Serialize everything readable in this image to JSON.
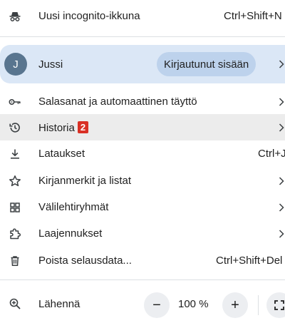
{
  "menu": {
    "incognito": {
      "label": "Uusi incognito-ikkuna",
      "shortcut": "Ctrl+Shift+N"
    },
    "profile": {
      "avatar_letter": "J",
      "name": "Jussi",
      "status": "Kirjautunut sisään"
    },
    "items": [
      {
        "label": "Salasanat ja automaattinen täyttö",
        "icon": "key-icon",
        "submenu": true
      },
      {
        "label": "Historia",
        "badge": "2",
        "icon": "history-icon",
        "submenu": true
      },
      {
        "label": "Lataukset",
        "shortcut": "Ctrl+J",
        "icon": "download-icon"
      },
      {
        "label": "Kirjanmerkit ja listat",
        "icon": "star-icon",
        "submenu": true
      },
      {
        "label": "Välilehtiryhmät",
        "icon": "tab-groups-icon",
        "submenu": true
      },
      {
        "label": "Laajennukset",
        "icon": "puzzle-icon",
        "submenu": true
      },
      {
        "label": "Poista selausdata...",
        "shortcut": "Ctrl+Shift+Del",
        "icon": "trash-icon"
      }
    ],
    "zoom": {
      "label": "Lähennä",
      "minus": "−",
      "value": "100 %",
      "plus": "+"
    }
  },
  "colors": {
    "profile_bg": "#dbe7f6",
    "signed_in_chip": "#bdd2ec",
    "avatar": "#59758f",
    "badge": "#d93025",
    "hover": "#ececec"
  }
}
